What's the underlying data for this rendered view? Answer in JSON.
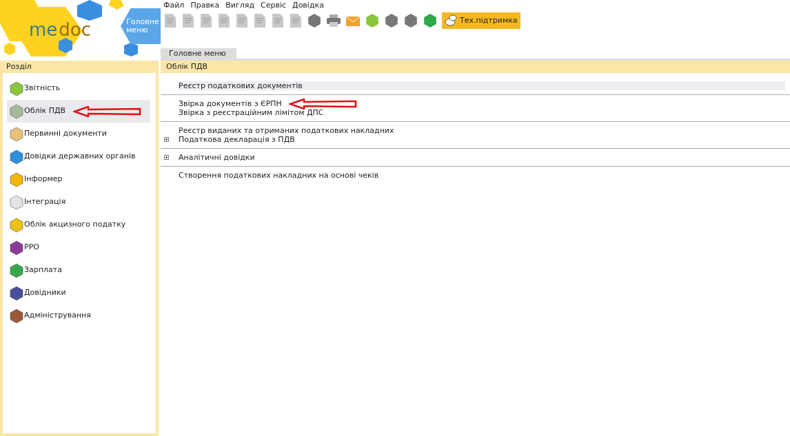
{
  "logo": {
    "text_1": "me",
    "text_2": "doc"
  },
  "main_menu_button": "Головне меню",
  "menu": [
    "Файл",
    "Правка",
    "Вигляд",
    "Сервіс",
    "Довідка"
  ],
  "support_button": "Тех.підтримка",
  "tabs": [
    {
      "label": "Головне меню",
      "selected": true
    }
  ],
  "sidebar": {
    "title": "Розділ",
    "items": [
      {
        "label": "Звітність",
        "selected": false,
        "color": "#8cc63f"
      },
      {
        "label": "Облік ПДВ",
        "selected": true,
        "color": "#a8b89a"
      },
      {
        "label": "Первинні документи",
        "selected": false,
        "color": "#e8c27a"
      },
      {
        "label": "Довідки державних органів",
        "selected": false,
        "color": "#2f8fd8"
      },
      {
        "label": "Інформер",
        "selected": false,
        "color": "#f2b705"
      },
      {
        "label": "Інтеграція",
        "selected": false,
        "color": "#e4e4e4"
      },
      {
        "label": "Облік акцизного податку",
        "selected": false,
        "color": "#e8c21a"
      },
      {
        "label": "РРО",
        "selected": false,
        "color": "#8a3a9a"
      },
      {
        "label": "Зарплата",
        "selected": false,
        "color": "#3aa64a"
      },
      {
        "label": "Довідники",
        "selected": false,
        "color": "#4b4f9a"
      },
      {
        "label": "Адміністрування",
        "selected": false,
        "color": "#9a5a3a"
      }
    ]
  },
  "content": {
    "title": "Облік ПДВ",
    "groups": [
      [
        {
          "label": "Реєстр податкових документів",
          "selected": true,
          "expandable": false
        }
      ],
      [
        {
          "label": "Звірка документів з ЄРПН",
          "selected": false,
          "expandable": false
        },
        {
          "label": "Звірка з реєстраційним лімітом ДПС",
          "selected": false,
          "expandable": false
        }
      ],
      [
        {
          "label": "Реєстр виданих та отриманих податкових накладних",
          "selected": false,
          "expandable": false
        },
        {
          "label": "Податкова декларація з ПДВ",
          "selected": false,
          "expandable": true
        }
      ],
      [
        {
          "label": "Аналітичні довідки",
          "selected": false,
          "expandable": true
        }
      ],
      [
        {
          "label": "Створення податкових накладних на основі чеків",
          "selected": false,
          "expandable": false
        }
      ]
    ]
  }
}
